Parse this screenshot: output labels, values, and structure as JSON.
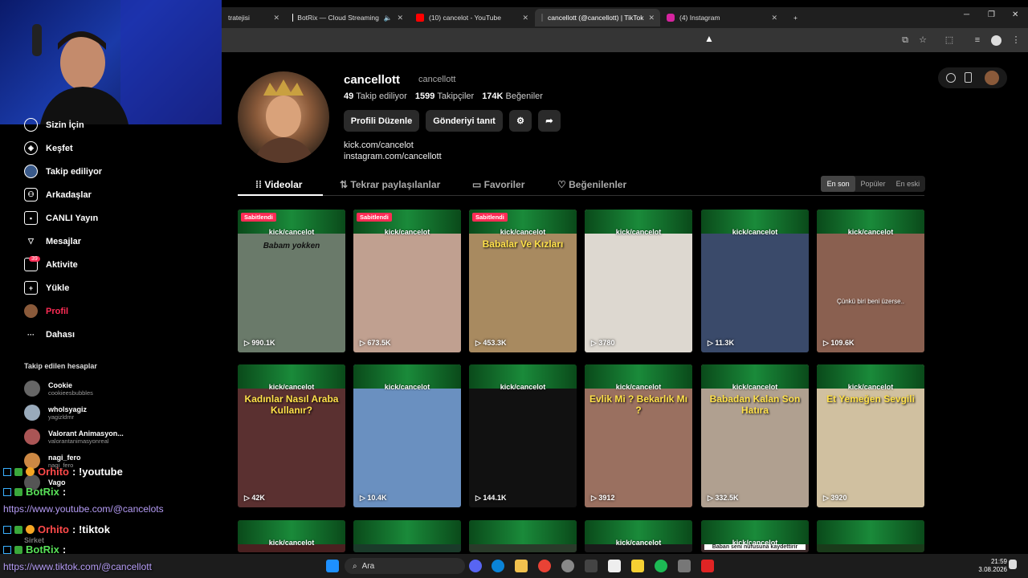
{
  "browser": {
    "tabs": [
      {
        "label": "tratejisi"
      },
      {
        "label": "BotRix — Cloud Streaming"
      },
      {
        "label": "(10) cancelot - YouTube"
      },
      {
        "label": "cancellott (@cancellott) | TikTok"
      },
      {
        "label": "(4) Instagram"
      }
    ]
  },
  "sidebar": {
    "items": [
      {
        "label": "Sizin İçin"
      },
      {
        "label": "Keşfet"
      },
      {
        "label": "Takip ediliyor"
      },
      {
        "label": "Arkadaşlar"
      },
      {
        "label": "CANLI Yayın"
      },
      {
        "label": "Mesajlar"
      },
      {
        "label": "Aktivite"
      },
      {
        "label": "Yükle"
      },
      {
        "label": "Profil"
      },
      {
        "label": "Dahası"
      }
    ],
    "activity_badge": "39",
    "following_title": "Takip edilen hesaplar",
    "accounts": [
      {
        "name": "Cookie",
        "handle": "cookieesbubbles"
      },
      {
        "name": "wholsyagiz",
        "handle": "yagizldmr"
      },
      {
        "name": "Valorant Animasyon...",
        "handle": "valorantanimasyonreal"
      },
      {
        "name": "nagi_fero",
        "handle": "nagi_fero"
      },
      {
        "name": "Vago",
        "handle": ""
      },
      {
        "name": "Sirket",
        "handle": ""
      }
    ]
  },
  "chat": [
    {
      "user": "Orhito",
      "msg": ": !youtube"
    },
    {
      "user": "BotRix",
      "msg": ":"
    },
    {
      "url": "https://www.youtube.com/@cancelots"
    },
    {
      "user": "Orhito",
      "msg": ": !tiktok"
    },
    {
      "user": "BotRix",
      "msg": ":"
    },
    {
      "url": "https://www.tiktok.com/@cancellott"
    }
  ],
  "profile": {
    "username": "cancellott",
    "nickname": "cancellott",
    "following": "49",
    "following_label": "Takip ediliyor",
    "followers": "1599",
    "followers_label": "Takipçiler",
    "likes": "174K",
    "likes_label": "Beğeniler",
    "edit_button": "Profili Düzenle",
    "promote_button": "Gönderiyi tanıt",
    "links": [
      "kick.com/cancelot",
      "instagram.com/cancellott"
    ]
  },
  "content_tabs": [
    "Videolar",
    "Tekrar paylaşılanlar",
    "Favoriler",
    "Beğenilenler"
  ],
  "sort": [
    "En son",
    "Popüler",
    "En eski"
  ],
  "videos": [
    {
      "pinned": "Sabitlendi",
      "kick": "kick/cancelot",
      "caption": "Babam yokken",
      "views": "990.1K"
    },
    {
      "pinned": "Sabitlendi",
      "kick": "kick/cancelot",
      "caption": "",
      "views": "673.5K"
    },
    {
      "pinned": "Sabitlendi",
      "kick": "kick/cancelot",
      "caption": "Babalar Ve Kızları",
      "views": "453.3K"
    },
    {
      "pinned": "",
      "kick": "kick/cancelot",
      "caption": "",
      "views": "3780"
    },
    {
      "pinned": "",
      "kick": "kick/cancelot",
      "caption": "",
      "views": "11.3K"
    },
    {
      "pinned": "",
      "kick": "kick/cancelot",
      "caption": "Çünkü biri beni üzerse..",
      "views": "109.6K"
    },
    {
      "pinned": "",
      "kick": "kick/cancelot",
      "caption": "Kadınlar Nasıl Araba Kullanır?",
      "views": "42K"
    },
    {
      "pinned": "",
      "kick": "kick/cancelot",
      "caption": "",
      "views": "10.4K"
    },
    {
      "pinned": "",
      "kick": "kick/cancelot",
      "caption": "",
      "views": "144.1K"
    },
    {
      "pinned": "",
      "kick": "kick/cancelot",
      "caption": "Evlik Mi ? Bekarlık Mı ?",
      "views": "3912"
    },
    {
      "pinned": "",
      "kick": "kick/cancelot",
      "caption": "Babadan Kalan Son Hatıra",
      "views": "332.5K"
    },
    {
      "pinned": "",
      "kick": "kick/cancelot",
      "caption": "Et Yemeğen Sevgili",
      "views": "3920"
    },
    {
      "pinned": "",
      "kick": "kick/cancelot",
      "caption": "",
      "views": ""
    },
    {
      "pinned": "",
      "kick": "",
      "caption": "",
      "views": ""
    },
    {
      "pinned": "",
      "kick": "",
      "caption": "",
      "views": ""
    },
    {
      "pinned": "",
      "kick": "kick/cancelot",
      "caption": "",
      "views": ""
    },
    {
      "pinned": "",
      "kick": "kick/cancelot",
      "caption": "Baban seni nüfusuna kaydettirir",
      "views": ""
    },
    {
      "pinned": "",
      "kick": "",
      "caption": "",
      "views": ""
    }
  ],
  "taskbar": {
    "search": "Ara",
    "time": "21:59",
    "date": "3.08.2026"
  }
}
